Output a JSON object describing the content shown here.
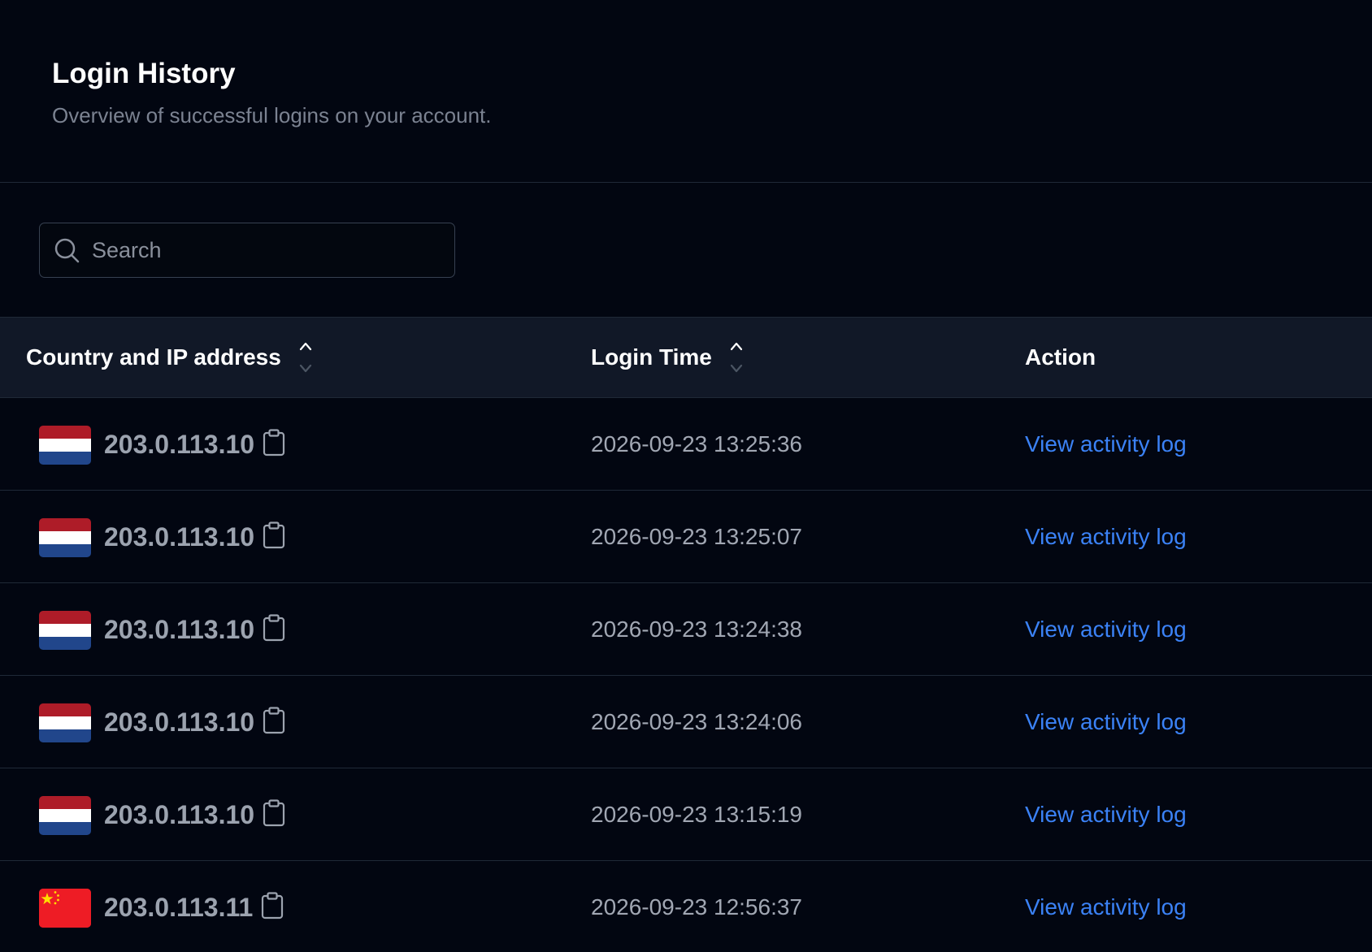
{
  "header": {
    "title": "Login History",
    "subtitle": "Overview of successful logins on your account."
  },
  "search": {
    "placeholder": "Search"
  },
  "table": {
    "columns": {
      "ip": "Country and IP address",
      "time": "Login Time",
      "action": "Action"
    },
    "rows": [
      {
        "country": "netherlands-flag",
        "ip": "203.0.113.10",
        "time": "2026-09-23 13:25:36",
        "action": "View activity log"
      },
      {
        "country": "netherlands-flag",
        "ip": "203.0.113.10",
        "time": "2026-09-23 13:25:07",
        "action": "View activity log"
      },
      {
        "country": "netherlands-flag",
        "ip": "203.0.113.10",
        "time": "2026-09-23 13:24:38",
        "action": "View activity log"
      },
      {
        "country": "netherlands-flag",
        "ip": "203.0.113.10",
        "time": "2026-09-23 13:24:06",
        "action": "View activity log"
      },
      {
        "country": "netherlands-flag",
        "ip": "203.0.113.10",
        "time": "2026-09-23 13:15:19",
        "action": "View activity log"
      },
      {
        "country": "china-flag",
        "ip": "203.0.113.11",
        "time": "2026-09-23 12:56:37",
        "action": "View activity log"
      }
    ]
  },
  "colors": {
    "background": "#020611",
    "header_row": "#111827",
    "link": "#3b82f6",
    "muted_text": "#9ca3af",
    "border": "#1f2937"
  },
  "icons": {
    "search": "search-icon",
    "sort": "sort-icon",
    "copy": "clipboard-icon"
  }
}
